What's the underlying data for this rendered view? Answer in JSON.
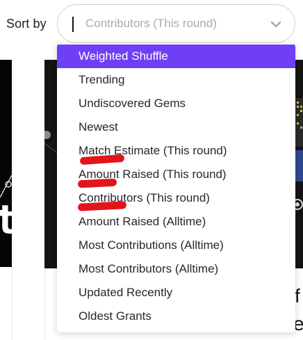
{
  "sort": {
    "label": "Sort by",
    "value": "Contributors (This round)",
    "chevron_icon": "chevron-down-icon"
  },
  "dropdown": {
    "selected_index": 0,
    "accent_color": "#6f3ff5",
    "options": [
      "Weighted Shuffle",
      "Trending",
      "Undiscovered Gems",
      "Newest",
      "Match Estimate (This round)",
      "Amount Raised (This round)",
      "Contributors (This round)",
      "Amount Raised (Alltime)",
      "Most Contributions (Alltime)",
      "Most Contributors (Alltime)",
      "Updated Recently",
      "Oldest Grants"
    ]
  },
  "annotations": {
    "scribble_color": "#e3141a"
  },
  "background_cards": {
    "left_glyph": "t",
    "right_text_1": "f",
    "right_text_2": "e"
  }
}
